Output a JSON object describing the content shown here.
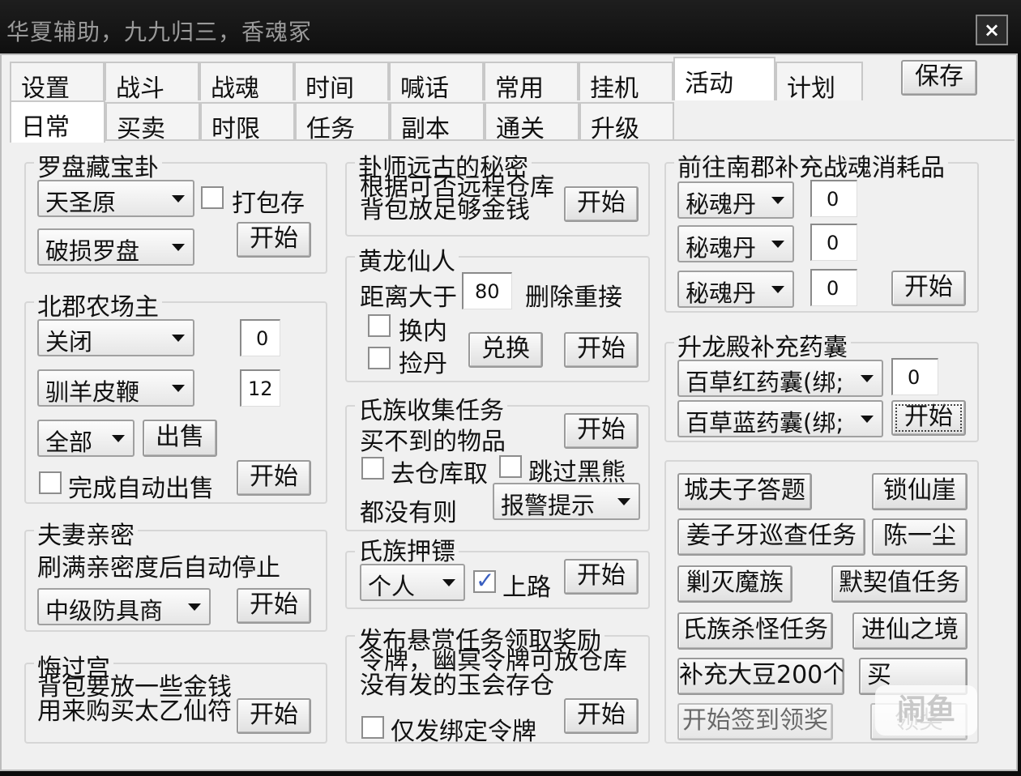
{
  "title": "华夏辅助，九九归三，香魂冢",
  "close": "×",
  "tabs_row1": [
    {
      "label": "设置"
    },
    {
      "label": "战斗"
    },
    {
      "label": "战魂"
    },
    {
      "label": "时间"
    },
    {
      "label": "喊话"
    },
    {
      "label": "常用"
    },
    {
      "label": "挂机"
    },
    {
      "label": "活动"
    },
    {
      "label": "计划"
    }
  ],
  "save": "保存",
  "tabs_row2": [
    {
      "label": "日常"
    },
    {
      "label": "买卖"
    },
    {
      "label": "时限"
    },
    {
      "label": "任务"
    },
    {
      "label": "副本"
    },
    {
      "label": "通关"
    },
    {
      "label": "升级"
    }
  ],
  "start": "开始",
  "luopan": {
    "title": "罗盘藏宝卦",
    "region": "天圣原",
    "pack": "打包存",
    "item": "破损罗盘"
  },
  "farm": {
    "title": "北郡农场主",
    "mode": "关闭",
    "count1": "0",
    "item": "驯羊皮鞭",
    "count2": "12",
    "scope": "全部",
    "sell": "出售",
    "auto": "完成自动出售"
  },
  "couple": {
    "title": "夫妻亲密",
    "desc": "刷满亲密度后自动停止",
    "merchant": "中级防具商"
  },
  "huiguo": {
    "title": "悔过宫",
    "desc1": "背包要放一些金钱",
    "desc2": "用来购买太乙仙符"
  },
  "guashi": {
    "title": "卦师远古的秘密",
    "desc1": "根据可否远程仓库",
    "desc2": "背包放足够金钱"
  },
  "huanglong": {
    "title": "黄龙仙人",
    "dist_label": "距离大于",
    "dist": "80",
    "redo": "删除重接",
    "opt1": "换内",
    "opt2": "捡丹",
    "exchange": "兑换"
  },
  "clan": {
    "title": "氏族收集任务",
    "desc": "买不到的物品",
    "opt1": "去仓库取",
    "opt2": "跳过黑熊",
    "none_label": "都没有则",
    "alarm": "报警提示"
  },
  "escort": {
    "title": "氏族押镖",
    "mode": "个人",
    "road": "上路"
  },
  "bounty": {
    "title": "发布悬赏任务领取奖励",
    "desc1": "令牌，幽冥令牌可放仓库",
    "desc2": "没有发的玉会存仓",
    "only": "仅发绑定令牌"
  },
  "nanjun": {
    "title": "前往南郡补充战魂消耗品",
    "rows": [
      {
        "item": "秘魂丹",
        "qty": "0"
      },
      {
        "item": "秘魂丹",
        "qty": "0"
      },
      {
        "item": "秘魂丹",
        "qty": "0"
      }
    ]
  },
  "shenglong": {
    "title": "升龙殿补充药囊",
    "red": "百草红药囊(绑;",
    "qty": "0",
    "blue": "百草蓝药囊(绑;"
  },
  "quick": [
    "城夫子答题",
    "锁仙崖",
    "姜子牙巡查任务",
    "陈一尘",
    "剿灭魔族",
    "默契值任务",
    "氏族杀怪任务",
    "进仙之境",
    "补充大豆200个",
    "买",
    "开始签到领奖",
    "领奖"
  ],
  "watermark": "闹鱼"
}
